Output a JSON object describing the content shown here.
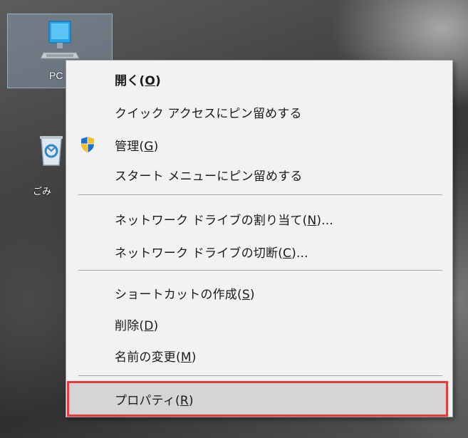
{
  "desktop": {
    "icons": [
      {
        "name": "pc",
        "label": "PC",
        "icon": "computer-icon"
      },
      {
        "name": "recycle-bin",
        "label": "ごみ",
        "icon": "recycle-bin-icon"
      }
    ]
  },
  "context_menu": {
    "items": [
      {
        "text": "開く(",
        "key": "O",
        "suffix": ")",
        "bold": true
      },
      {
        "text": "クイック アクセスにピン留めする",
        "key": "",
        "suffix": ""
      },
      {
        "text": "管理(",
        "key": "G",
        "suffix": ")",
        "icon": "shield-icon"
      },
      {
        "text": "スタート メニューにピン留めする",
        "key": "",
        "suffix": ""
      },
      {
        "text": "ネットワーク ドライブの割り当て(",
        "key": "N",
        "suffix": ")..."
      },
      {
        "text": "ネットワーク ドライブの切断(",
        "key": "C",
        "suffix": ")..."
      },
      {
        "text": "ショートカットの作成(",
        "key": "S",
        "suffix": ")"
      },
      {
        "text": "削除(",
        "key": "D",
        "suffix": ")"
      },
      {
        "text": "名前の変更(",
        "key": "M",
        "suffix": ")"
      },
      {
        "text": "プロパティ(",
        "key": "R",
        "suffix": ")",
        "highlighted": true
      }
    ]
  },
  "colors": {
    "highlight_border": "#e53c3c",
    "menu_background": "#f2f2f2",
    "hover_background": "#d5d5d5"
  }
}
